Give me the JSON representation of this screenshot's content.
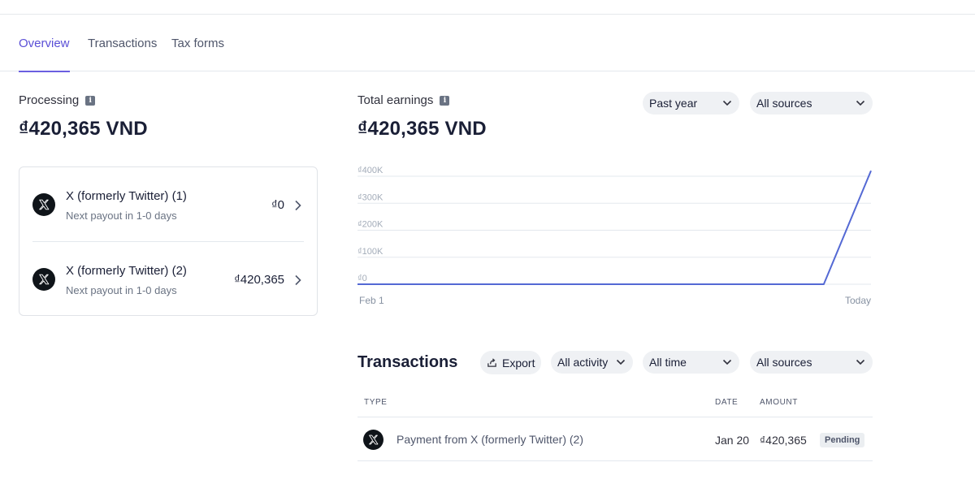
{
  "tabs": [
    {
      "label": "Overview",
      "active": true
    },
    {
      "label": "Transactions",
      "active": false
    },
    {
      "label": "Tax forms",
      "active": false
    }
  ],
  "processing": {
    "label": "Processing",
    "amount": "₫420,365 VND",
    "payouts": [
      {
        "name": "X (formerly Twitter) (1)",
        "subtitle": "Next payout in 1-0 days",
        "amount": "₫0"
      },
      {
        "name": "X (formerly Twitter) (2)",
        "subtitle": "Next payout in 1-0 days",
        "amount": "₫420,365"
      }
    ]
  },
  "earnings": {
    "label": "Total earnings",
    "amount": "₫420,365 VND",
    "period_select": "Past year",
    "source_select": "All sources"
  },
  "chart_data": {
    "type": "line",
    "x": [
      "Feb 1",
      "Jan 19",
      "Today"
    ],
    "x_fraction": [
      0,
      0.908,
      1
    ],
    "values": [
      0,
      0,
      420365
    ],
    "y_ticks": [
      {
        "label": "₫400K",
        "value": 400000
      },
      {
        "label": "₫300K",
        "value": 300000
      },
      {
        "label": "₫200K",
        "value": 200000
      },
      {
        "label": "₫100K",
        "value": 100000
      },
      {
        "label": "₫0",
        "value": 0
      }
    ],
    "x_tick_labels": [
      "Feb 1",
      "Today"
    ],
    "ylim": [
      0,
      400000
    ],
    "grid": true,
    "line_color": "#5469d4"
  },
  "transactions": {
    "title": "Transactions",
    "export_label": "Export",
    "activity_select": "All activity",
    "time_select": "All time",
    "source_select": "All sources",
    "columns": {
      "type": "TYPE",
      "date": "DATE",
      "amount": "AMOUNT"
    },
    "rows": [
      {
        "description": "Payment from X (formerly Twitter) (2)",
        "date": "Jan 20",
        "amount": "₫420,365",
        "status": "Pending"
      }
    ]
  },
  "icons": {
    "brand": "x-logo-icon",
    "info": "info-icon",
    "dropdown": "chevron-down-icon",
    "export": "export-icon"
  },
  "colors": {
    "accent": "#5a4fd6",
    "chart_line": "#5469d4",
    "pill_bg": "#eff1f4"
  }
}
